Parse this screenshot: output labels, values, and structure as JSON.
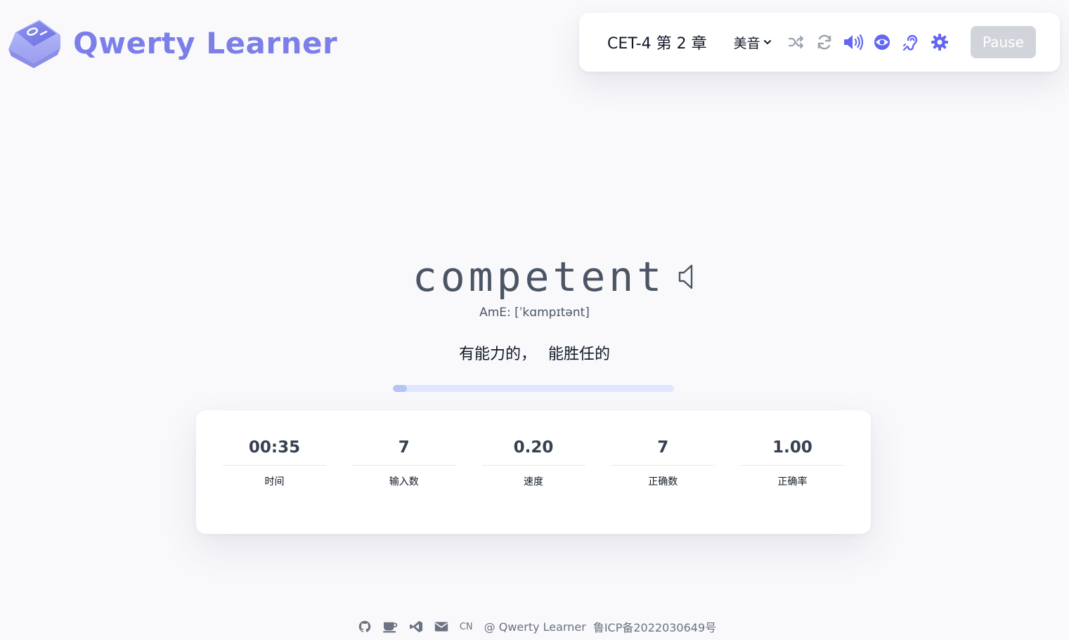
{
  "header": {
    "app_name": "Qwerty Learner"
  },
  "toolbar": {
    "dictionary_chapter": "CET-4 第 2 章",
    "accent": "美音",
    "icons": [
      "shuffle-icon",
      "loop-icon",
      "sound-icon",
      "eye-icon",
      "ear-icon",
      "settings-icon"
    ],
    "pause_label": "Pause"
  },
  "word": {
    "text": "competent",
    "phonetic": "AmE: [ˈkɑmpɪtənt]",
    "translation": "有能力的， 能胜任的"
  },
  "progress": {
    "fraction": 0.05
  },
  "stats": [
    {
      "value": "00:35",
      "label": "时间"
    },
    {
      "value": "7",
      "label": "输入数"
    },
    {
      "value": "0.20",
      "label": "速度"
    },
    {
      "value": "7",
      "label": "正确数"
    },
    {
      "value": "1.00",
      "label": "正确率"
    }
  ],
  "footer": {
    "icons": [
      "github-icon",
      "coffee-icon",
      "vscode-icon",
      "mail-icon"
    ],
    "language": "CN",
    "copyright": "@ Qwerty Learner",
    "icp": "鲁ICP备2022030649号"
  },
  "colors": {
    "accent": "#7c7fe8",
    "icon": "#6366f1",
    "pause_bg": "#d1d5db",
    "progress_track": "#e0e7ff",
    "progress_fill": "#b5c3f5"
  }
}
